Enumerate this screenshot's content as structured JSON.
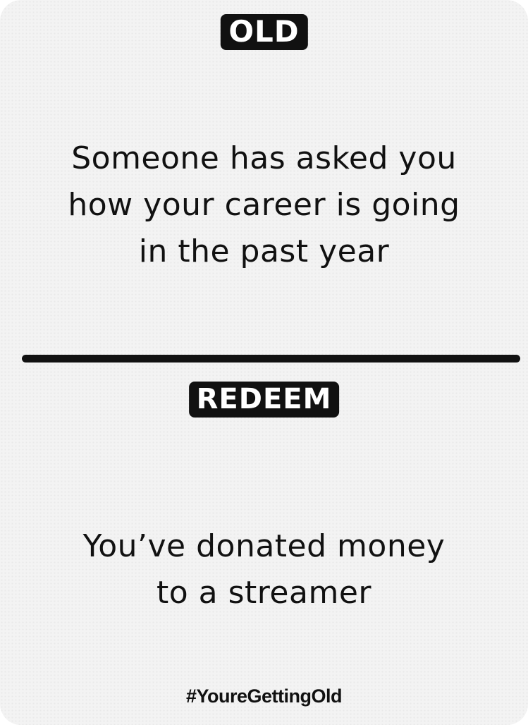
{
  "card": {
    "old": {
      "badge_label": "OLD",
      "prompt_lines": [
        "Someone has asked you",
        "how your career is going",
        "in the past year"
      ]
    },
    "redeem": {
      "badge_label": "REDEEM",
      "prompt_lines": [
        "You’ve donated money",
        "to a streamer"
      ]
    },
    "hashtag": "#YoureGettingOld"
  },
  "colors": {
    "ink": "#111111",
    "card_background": "#f3f3f3"
  }
}
